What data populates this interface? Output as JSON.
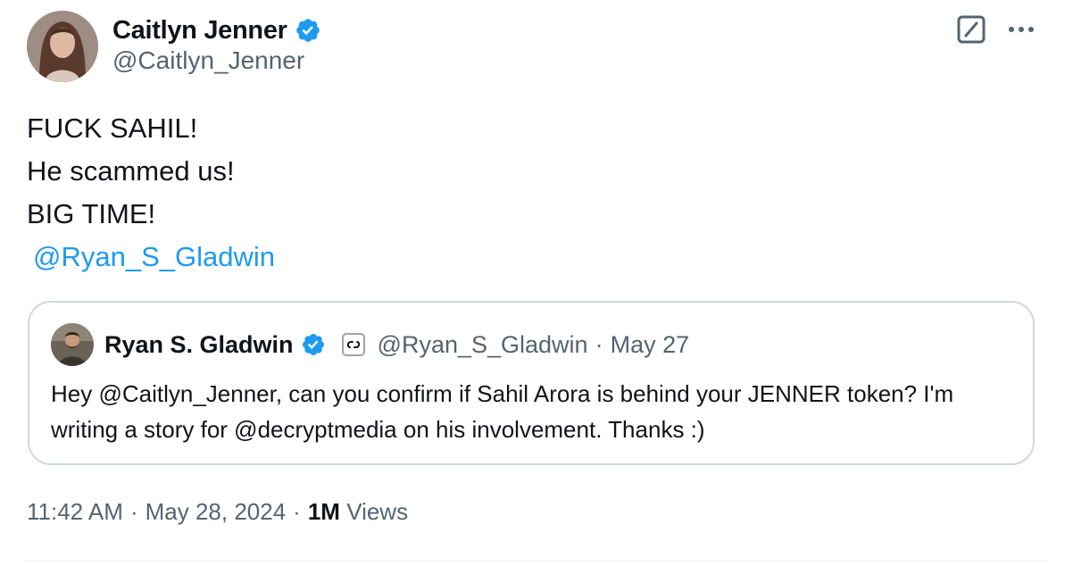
{
  "author": {
    "display_name": "Caitlyn Jenner",
    "handle": "@Caitlyn_Jenner",
    "verified": true
  },
  "toolbar": {
    "grok_icon": "grok-icon",
    "more_icon": "more-options-icon"
  },
  "tweet": {
    "lines": [
      "FUCK SAHIL!",
      "He scammed us!",
      "BIG TIME!"
    ],
    "mention": "@Ryan_S_Gladwin"
  },
  "quoted_tweet": {
    "display_name": "Ryan S. Gladwin",
    "verified": true,
    "affiliation_icon": "affiliate-badge-icon",
    "handle": "@Ryan_S_Gladwin",
    "separator": "·",
    "date": "May 27",
    "text": "Hey @Caitlyn_Jenner, can you confirm if Sahil Arora is behind your JENNER token? I'm writing a story for @decryptmedia on his involvement. Thanks :)"
  },
  "meta": {
    "time": "11:42 AM",
    "sep1": "·",
    "date": "May 28, 2024",
    "sep2": "·",
    "views_count": "1M",
    "views_label": "Views"
  },
  "colors": {
    "accent": "#1d9bf0",
    "secondary_text": "#536471",
    "border": "#cfd9de"
  }
}
